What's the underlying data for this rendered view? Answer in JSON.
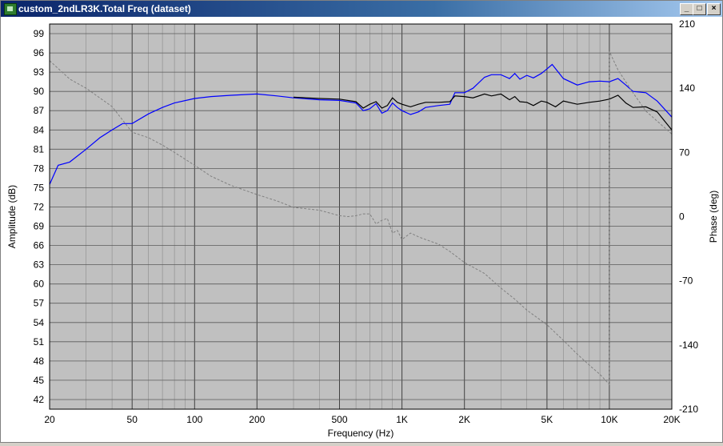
{
  "window": {
    "title": "custom_2ndLR3K.Total Freq (dataset)",
    "minimize_icon": "minimize-icon",
    "maximize_icon": "maximize-icon",
    "close_icon": "close-icon"
  },
  "colors": {
    "plot_bg": "#c0c0c0",
    "grid": "#404040",
    "series_blue": "#0000ff",
    "series_black": "#000000",
    "phase": "#808080"
  },
  "chart_data": {
    "type": "line",
    "xlabel": "Frequency (Hz)",
    "ylabel": "Amplitude (dB)",
    "y2label": "Phase (deg)",
    "xscale": "log",
    "xlim": [
      20,
      20000
    ],
    "ylim": [
      40.5,
      100.5
    ],
    "y2lim": [
      -210,
      210
    ],
    "grid": true,
    "x_ticks": [
      {
        "value": 20,
        "label": "20"
      },
      {
        "value": 50,
        "label": "50"
      },
      {
        "value": 100,
        "label": "100"
      },
      {
        "value": 200,
        "label": "200"
      },
      {
        "value": 500,
        "label": "500"
      },
      {
        "value": 1000,
        "label": "1K"
      },
      {
        "value": 2000,
        "label": "2K"
      },
      {
        "value": 5000,
        "label": "5K"
      },
      {
        "value": 10000,
        "label": "10K"
      },
      {
        "value": 20000,
        "label": "20K"
      }
    ],
    "y_ticks": [
      99,
      96,
      93,
      90,
      87,
      84,
      81,
      78,
      75,
      72,
      69,
      66,
      63,
      60,
      57,
      54,
      51,
      48,
      45,
      42
    ],
    "y2_ticks": [
      210,
      140,
      70,
      0,
      -70,
      -140,
      -210
    ],
    "series": [
      {
        "axis": "left",
        "color": "#0000ff",
        "style": "solid",
        "x": [
          20,
          22,
          25,
          30,
          35,
          40,
          45,
          50,
          60,
          70,
          80,
          100,
          120,
          150,
          200,
          250,
          300,
          400,
          500,
          600,
          650,
          700,
          750,
          800,
          850,
          900,
          950,
          1000,
          1100,
          1200,
          1300,
          1500,
          1700,
          1800,
          2000,
          2200,
          2500,
          2700,
          3000,
          3300,
          3500,
          3700,
          4000,
          4300,
          4700,
          5000,
          5300,
          6000,
          7000,
          8000,
          9000,
          10000,
          11000,
          12000,
          13000,
          15000,
          17000,
          20000
        ],
        "values": [
          75.5,
          78.5,
          79.0,
          81.0,
          82.8,
          84.0,
          85.0,
          85.0,
          86.5,
          87.5,
          88.2,
          88.9,
          89.2,
          89.4,
          89.6,
          89.3,
          89.0,
          88.7,
          88.6,
          88.2,
          87.0,
          87.3,
          88.1,
          86.6,
          87.0,
          88.2,
          87.5,
          87.0,
          86.4,
          86.8,
          87.5,
          87.8,
          88.0,
          89.8,
          89.8,
          90.5,
          92.2,
          92.6,
          92.6,
          92.0,
          92.8,
          91.9,
          92.5,
          92.1,
          92.8,
          93.5,
          94.2,
          92.0,
          91.0,
          91.5,
          91.6,
          91.5,
          92.0,
          91.0,
          90.0,
          89.8,
          88.5,
          86.0
        ]
      },
      {
        "axis": "left",
        "color": "#000000",
        "style": "solid",
        "x": [
          300,
          400,
          500,
          600,
          650,
          700,
          750,
          800,
          850,
          900,
          950,
          1000,
          1100,
          1200,
          1300,
          1500,
          1700,
          1800,
          2000,
          2200,
          2500,
          2700,
          3000,
          3300,
          3500,
          3700,
          4000,
          4300,
          4700,
          5000,
          5500,
          6000,
          7000,
          8000,
          9000,
          10000,
          11000,
          12000,
          13000,
          15000,
          17000,
          20000
        ],
        "values": [
          89.1,
          88.9,
          88.8,
          88.4,
          87.4,
          88.0,
          88.4,
          87.4,
          87.8,
          89.0,
          88.3,
          88.0,
          87.6,
          88.0,
          88.3,
          88.3,
          88.4,
          89.3,
          89.2,
          89.0,
          89.6,
          89.3,
          89.6,
          88.7,
          89.2,
          88.4,
          88.3,
          87.8,
          88.5,
          88.3,
          87.6,
          88.5,
          88.0,
          88.3,
          88.5,
          88.8,
          89.4,
          88.2,
          87.5,
          87.6,
          86.8,
          84.0
        ]
      },
      {
        "axis": "right",
        "color": "#808080",
        "style": "dashed",
        "x": [
          20,
          25,
          30,
          40,
          50,
          60,
          70,
          80,
          100,
          120,
          150,
          200,
          250,
          300,
          400,
          500,
          550,
          600,
          650,
          700,
          750,
          800,
          850,
          900,
          950,
          1000,
          1100,
          1200,
          1300,
          1500,
          1700,
          2000,
          2500,
          3000,
          3500,
          4000,
          5000,
          6000,
          7000,
          8000,
          9000,
          10000,
          10010,
          11000,
          13000,
          15000,
          20000
        ],
        "values": [
          170,
          150,
          140,
          120,
          92,
          86,
          78,
          70,
          56,
          44,
          34,
          24,
          17,
          10,
          7,
          1,
          0,
          1,
          3,
          3,
          -8,
          -4,
          -2,
          -18,
          -15,
          -25,
          -18,
          -22,
          -25,
          -30,
          -38,
          -50,
          -62,
          -78,
          -90,
          -102,
          -118,
          -135,
          -150,
          -162,
          -172,
          -183,
          180,
          160,
          135,
          115,
          90
        ]
      }
    ]
  }
}
